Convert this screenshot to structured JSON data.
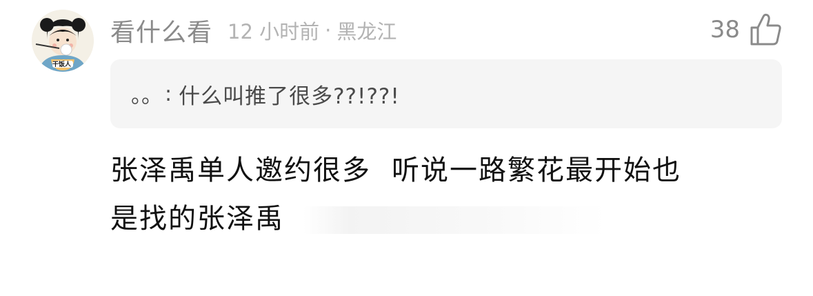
{
  "comment": {
    "username": "看什么看",
    "time": "12 小时前",
    "dot": "·",
    "location": "黑龙江",
    "likes": "38",
    "avatar_caption": "干饭人",
    "avatar_icon": "rice-eating-girl-avatar",
    "like_icon": "thumbs-up-icon",
    "quote": {
      "author": "。。",
      "separator": ":",
      "text": "什么叫推了很多??!??!"
    },
    "content_line1_part1": "张泽禹单人邀约很多",
    "content_line1_part2": "听说一路繁花最开始也",
    "content_line2": "是找的张泽禹"
  },
  "colors": {
    "username": "#8a8a8a",
    "meta": "#b3b3b3",
    "quote_bg": "#f5f5f5",
    "content": "#111111"
  }
}
